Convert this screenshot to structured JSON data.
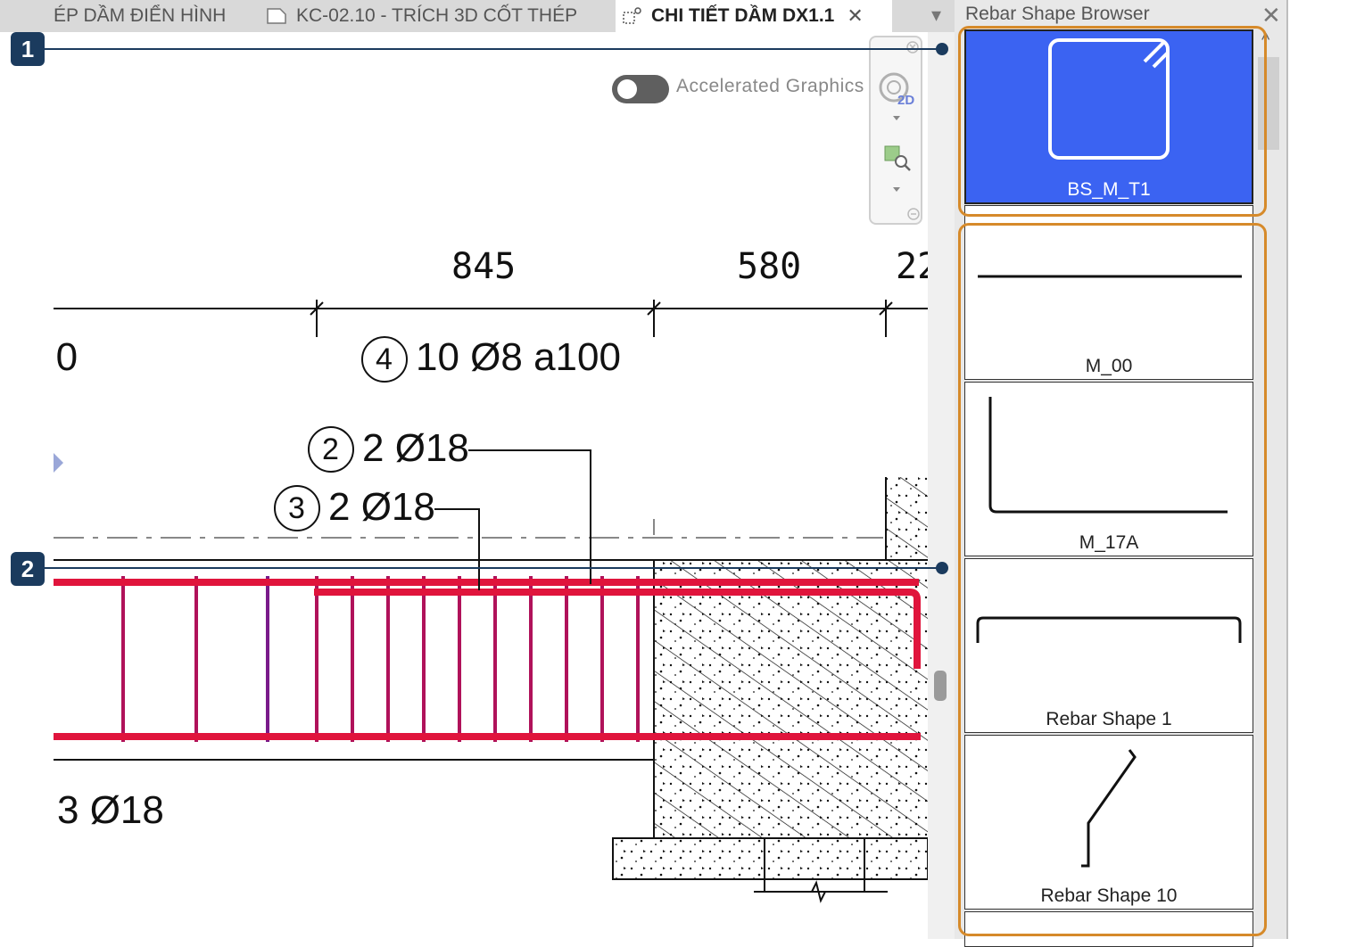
{
  "tabs": [
    {
      "label": "ÉP DẦM ĐIỂN HÌNH"
    },
    {
      "label": "KC-02.10 - TRÍCH 3D CỐT THÉP"
    },
    {
      "label": "CHI TIẾT DẦM DX1.1"
    }
  ],
  "tab_close": "✕",
  "tab_menu": "▾",
  "view": {
    "toggle_label": "Accelerated Graphics",
    "nav_2d_label": "2D"
  },
  "drawing": {
    "dims": [
      "845",
      "580",
      "22"
    ],
    "left_partial": ")0",
    "tag4": {
      "num": "4",
      "text": "10 Ø8 a100"
    },
    "tag2": {
      "num": "2",
      "text": "2 Ø18"
    },
    "tag3": {
      "num": "3",
      "text": "2 Ø18"
    },
    "bottom_label": "3 Ø18"
  },
  "panel": {
    "title": "Rebar Shape Browser",
    "close": "✕",
    "up_arrow": "^",
    "shapes": [
      {
        "name": "BS_M_T1"
      },
      {
        "name": "M_00"
      },
      {
        "name": "M_17A"
      },
      {
        "name": "Rebar Shape 1"
      },
      {
        "name": "Rebar Shape 10"
      }
    ]
  },
  "callouts": [
    "1",
    "2"
  ],
  "colors": {
    "rebar_red": "#e0143c",
    "stirrup": "#b0125a",
    "selected_blue": "#3b63f2",
    "highlight_orange": "#d68a2a",
    "callout_navy": "#1b3b5e"
  }
}
